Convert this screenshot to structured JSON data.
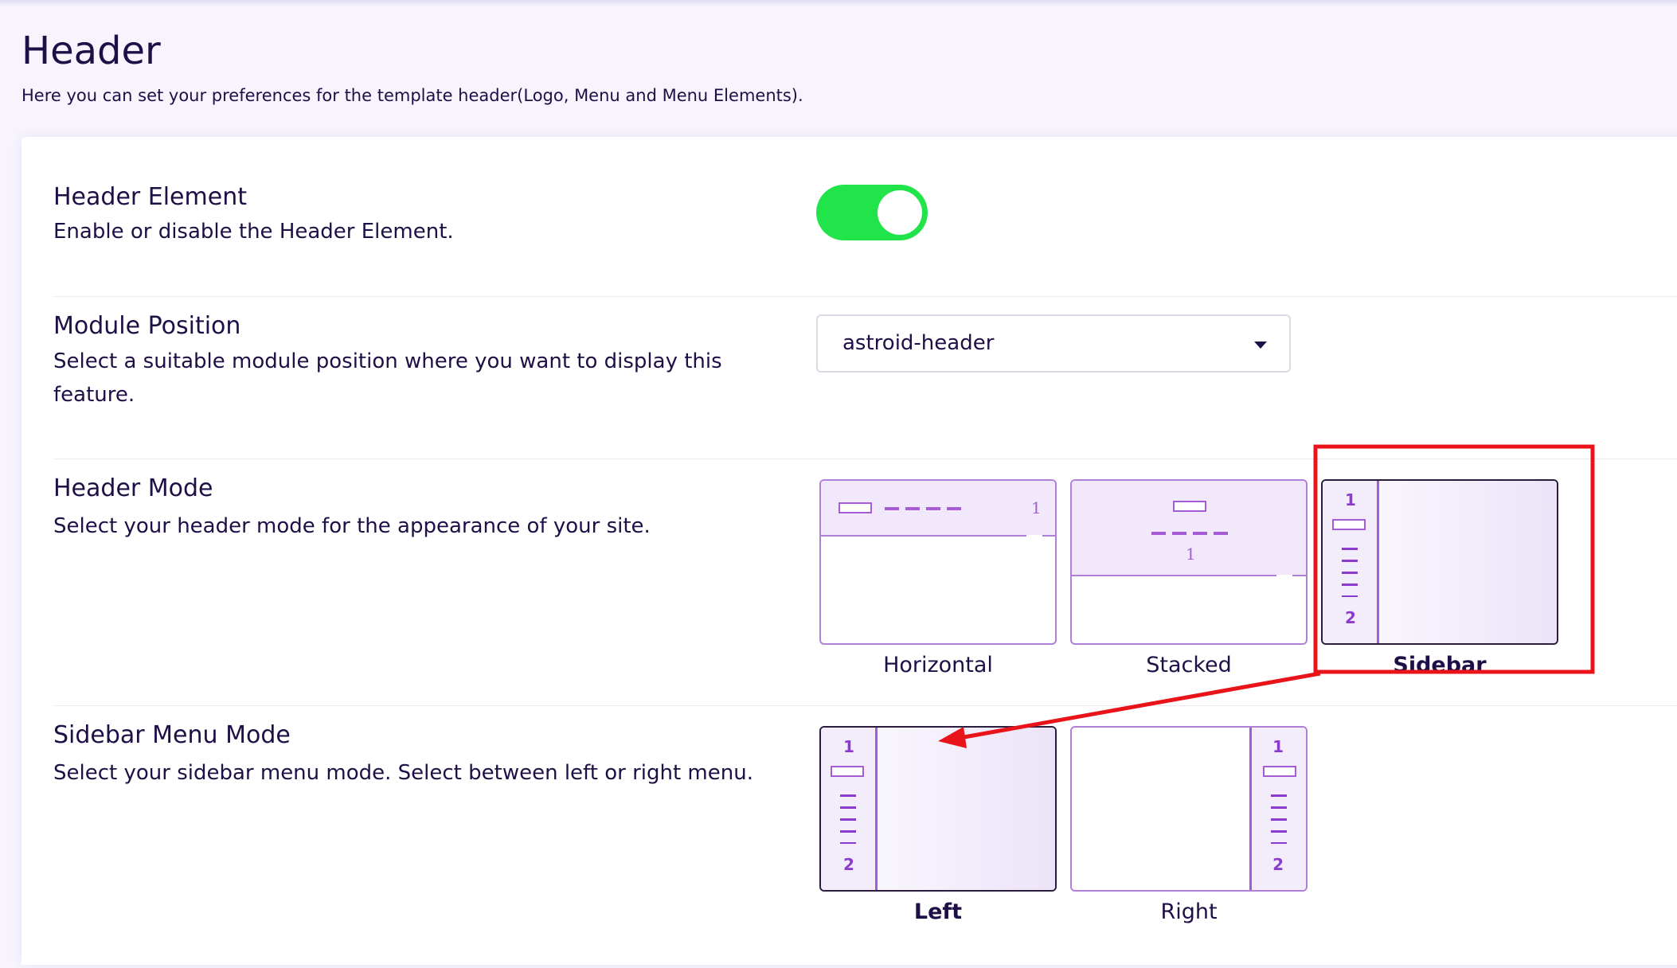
{
  "page": {
    "title": "Header",
    "subtitle": "Here you can set your preferences for the template header(Logo, Menu and Menu Elements)."
  },
  "settings": {
    "header_element": {
      "title": "Header Element",
      "description": "Enable or disable the Header Element.",
      "enabled": true
    },
    "module_position": {
      "title": "Module Position",
      "description": "Select a suitable module position where you want to display this feature.",
      "selected": "astroid-header"
    },
    "header_mode": {
      "title": "Header Mode",
      "description": "Select your header mode for the appearance of your site.",
      "selected": "Sidebar",
      "options": [
        {
          "label": "Horizontal",
          "num": "1"
        },
        {
          "label": "Stacked",
          "num": "1"
        },
        {
          "label": "Sidebar",
          "num1": "1",
          "num2": "2"
        }
      ]
    },
    "sidebar_menu_mode": {
      "title": "Sidebar Menu Mode",
      "description": "Select your sidebar menu mode. Select between left or right menu.",
      "selected": "Left",
      "options": [
        {
          "label": "Left",
          "num1": "1",
          "num2": "2"
        },
        {
          "label": "Right",
          "num1": "1",
          "num2": "2"
        }
      ]
    }
  },
  "colors": {
    "accent": "#a55cd6",
    "toggle_on": "#21e44a",
    "annotation": "#e8141a"
  }
}
